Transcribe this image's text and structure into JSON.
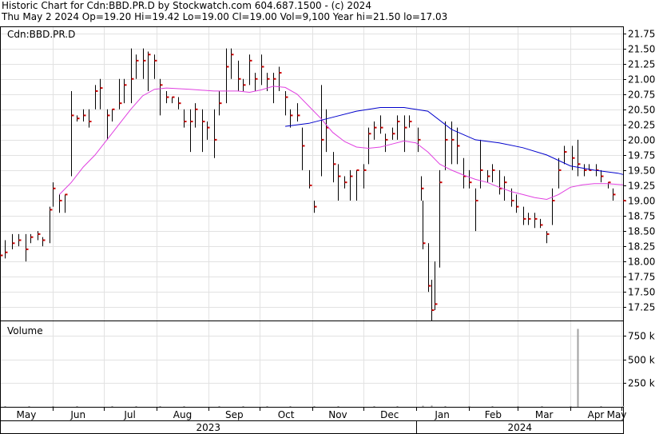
{
  "header": {
    "line1": "Historic Chart for Cdn:BBD.PR.D by Stockwatch.com 604.687.1500 - (c) 2024",
    "line2": "Thu May  2 2024   Op=19.20  Hi=19.42  Lo=19.00  Cl=19.00  Vol=9,100  Year hi=21.50  lo=17.03"
  },
  "price_panel": {
    "symbol": "Cdn:BBD.PR.D",
    "y_ticks": [
      "21.75",
      "21.50",
      "21.25",
      "21.00",
      "20.75",
      "20.50",
      "20.25",
      "20.00",
      "19.75",
      "19.50",
      "19.25",
      "19.00",
      "18.75",
      "18.50",
      "18.25",
      "18.00",
      "17.75",
      "17.50",
      "17.25"
    ]
  },
  "volume_panel": {
    "label": "Volume",
    "y_ticks": [
      "750 k",
      "500 k",
      "250 k"
    ]
  },
  "x_axis": {
    "months": [
      "May",
      "Jun",
      "Jul",
      "Aug",
      "Sep",
      "Oct",
      "Nov",
      "Dec",
      "Jan",
      "Feb",
      "Mar",
      "Apr",
      "May"
    ],
    "years": [
      "2023",
      "2024"
    ]
  },
  "colors": {
    "bars": "#000000",
    "close_tick": "#cc0000",
    "ma_short": "#e040e0",
    "ma_long": "#0000cc",
    "volume": "#a0a0a0"
  },
  "chart_data": {
    "type": "ohlc",
    "title": "Historic Chart for Cdn:BBD.PR.D",
    "ylim": [
      17.03,
      21.85
    ],
    "volume_ylim": [
      0,
      900000
    ],
    "x_start": "2023-05-01",
    "x_end": "2024-05-02",
    "ohlc": [
      [
        "2023-05-01",
        18.45,
        18.1,
        18.1
      ],
      [
        "2023-05-04",
        18.35,
        18.05,
        18.15
      ],
      [
        "2023-05-08",
        18.45,
        18.2,
        18.3
      ],
      [
        "2023-05-12",
        18.45,
        18.25,
        18.35
      ],
      [
        "2023-05-16",
        18.45,
        18.0,
        18.2
      ],
      [
        "2023-05-19",
        18.45,
        18.3,
        18.4
      ],
      [
        "2023-05-23",
        18.5,
        18.35,
        18.45
      ],
      [
        "2023-05-26",
        18.4,
        18.25,
        18.35
      ],
      [
        "2023-05-30",
        18.9,
        18.3,
        18.85
      ],
      [
        "2023-06-01",
        19.3,
        18.9,
        19.2
      ],
      [
        "2023-06-05",
        19.1,
        18.8,
        19.0
      ],
      [
        "2023-06-08",
        19.1,
        18.8,
        19.1
      ],
      [
        "2023-06-12",
        20.8,
        19.4,
        20.4
      ],
      [
        "2023-06-15",
        20.4,
        20.3,
        20.35
      ],
      [
        "2023-06-19",
        20.5,
        20.3,
        20.4
      ],
      [
        "2023-06-22",
        20.5,
        20.2,
        20.3
      ],
      [
        "2023-06-26",
        20.9,
        20.5,
        20.8
      ],
      [
        "2023-06-29",
        21.0,
        20.5,
        20.85
      ],
      [
        "2023-07-03",
        20.5,
        20.0,
        20.4
      ],
      [
        "2023-07-06",
        20.5,
        20.3,
        20.5
      ],
      [
        "2023-07-10",
        21.0,
        20.5,
        20.6
      ],
      [
        "2023-07-13",
        21.0,
        20.6,
        20.9
      ],
      [
        "2023-07-17",
        21.5,
        20.6,
        21.0
      ],
      [
        "2023-07-20",
        21.4,
        21.0,
        21.3
      ],
      [
        "2023-07-24",
        21.5,
        21.0,
        21.3
      ],
      [
        "2023-07-27",
        21.45,
        20.8,
        21.4
      ],
      [
        "2023-07-31",
        21.4,
        21.0,
        21.3
      ],
      [
        "2023-08-03",
        21.0,
        20.4,
        20.9
      ],
      [
        "2023-08-07",
        20.8,
        20.6,
        20.7
      ],
      [
        "2023-08-10",
        20.7,
        20.6,
        20.7
      ],
      [
        "2023-08-14",
        20.7,
        20.5,
        20.6
      ],
      [
        "2023-08-17",
        20.5,
        20.2,
        20.3
      ],
      [
        "2023-08-21",
        20.5,
        19.8,
        20.3
      ],
      [
        "2023-08-24",
        20.6,
        20.2,
        20.5
      ],
      [
        "2023-08-28",
        20.5,
        19.8,
        20.3
      ],
      [
        "2023-08-31",
        20.3,
        20.0,
        20.2
      ],
      [
        "2023-09-04",
        20.5,
        19.7,
        20.0
      ],
      [
        "2023-09-07",
        20.8,
        20.4,
        20.6
      ],
      [
        "2023-09-11",
        21.5,
        20.6,
        21.2
      ],
      [
        "2023-09-14",
        21.5,
        21.0,
        21.4
      ],
      [
        "2023-09-18",
        21.3,
        20.8,
        21.0
      ],
      [
        "2023-09-21",
        21.0,
        20.8,
        20.9
      ],
      [
        "2023-09-25",
        21.4,
        20.9,
        21.3
      ],
      [
        "2023-09-28",
        21.1,
        20.8,
        21.0
      ],
      [
        "2023-10-02",
        21.4,
        20.9,
        21.2
      ],
      [
        "2023-10-05",
        21.1,
        20.8,
        21.0
      ],
      [
        "2023-10-09",
        21.1,
        20.6,
        21.0
      ],
      [
        "2023-10-12",
        21.2,
        20.8,
        21.1
      ],
      [
        "2023-10-16",
        20.8,
        20.4,
        20.7
      ],
      [
        "2023-10-19",
        20.5,
        20.2,
        20.4
      ],
      [
        "2023-10-23",
        20.6,
        20.3,
        20.4
      ],
      [
        "2023-10-26",
        20.2,
        19.5,
        19.9
      ],
      [
        "2023-10-30",
        19.5,
        19.2,
        19.25
      ],
      [
        "2023-11-02",
        19.0,
        18.8,
        18.9
      ],
      [
        "2023-11-06",
        20.9,
        19.4,
        20.0
      ],
      [
        "2023-11-09",
        20.5,
        19.8,
        20.2
      ],
      [
        "2023-11-13",
        19.8,
        19.3,
        19.6
      ],
      [
        "2023-11-16",
        19.6,
        19.0,
        19.4
      ],
      [
        "2023-11-20",
        19.4,
        19.2,
        19.3
      ],
      [
        "2023-11-23",
        19.5,
        19.0,
        19.4
      ],
      [
        "2023-11-27",
        19.5,
        19.0,
        19.5
      ],
      [
        "2023-12-01",
        19.6,
        19.2,
        19.5
      ],
      [
        "2023-12-04",
        20.2,
        19.6,
        20.1
      ],
      [
        "2023-12-07",
        20.3,
        20.0,
        20.2
      ],
      [
        "2023-12-11",
        20.4,
        20.1,
        20.2
      ],
      [
        "2023-12-14",
        20.1,
        19.8,
        20.0
      ],
      [
        "2023-12-18",
        20.2,
        20.0,
        20.1
      ],
      [
        "2023-12-21",
        20.4,
        20.0,
        20.3
      ],
      [
        "2023-12-25",
        20.4,
        19.8,
        20.2
      ],
      [
        "2023-12-28",
        20.4,
        20.2,
        20.3
      ],
      [
        "2024-01-02",
        20.2,
        19.8,
        20.0
      ],
      [
        "2024-01-04",
        19.4,
        19.0,
        19.2
      ],
      [
        "2024-01-05",
        19.0,
        18.2,
        18.3
      ],
      [
        "2024-01-08",
        18.3,
        17.5,
        17.6
      ],
      [
        "2024-01-10",
        17.7,
        17.03,
        17.2
      ],
      [
        "2024-01-12",
        18.0,
        17.2,
        17.3
      ],
      [
        "2024-01-15",
        19.5,
        17.9,
        19.3
      ],
      [
        "2024-01-18",
        20.3,
        19.5,
        20.0
      ],
      [
        "2024-01-22",
        20.3,
        19.6,
        20.0
      ],
      [
        "2024-01-25",
        20.2,
        19.6,
        19.9
      ],
      [
        "2024-01-29",
        19.7,
        19.2,
        19.4
      ],
      [
        "2024-02-01",
        19.5,
        19.2,
        19.3
      ],
      [
        "2024-02-05",
        19.2,
        18.5,
        19.0
      ],
      [
        "2024-02-08",
        20.0,
        19.2,
        19.5
      ],
      [
        "2024-02-12",
        19.5,
        19.3,
        19.4
      ],
      [
        "2024-02-15",
        19.6,
        19.3,
        19.5
      ],
      [
        "2024-02-19",
        19.5,
        19.1,
        19.2
      ],
      [
        "2024-02-22",
        19.4,
        19.0,
        19.3
      ],
      [
        "2024-02-26",
        19.2,
        18.9,
        19.0
      ],
      [
        "2024-02-29",
        19.1,
        18.8,
        18.9
      ],
      [
        "2024-03-04",
        18.9,
        18.6,
        18.7
      ],
      [
        "2024-03-07",
        18.8,
        18.6,
        18.7
      ],
      [
        "2024-03-11",
        18.8,
        18.55,
        18.7
      ],
      [
        "2024-03-14",
        18.7,
        18.55,
        18.6
      ],
      [
        "2024-03-18",
        18.5,
        18.3,
        18.45
      ],
      [
        "2024-03-21",
        19.2,
        18.6,
        19.0
      ],
      [
        "2024-03-25",
        19.7,
        19.2,
        19.5
      ],
      [
        "2024-03-28",
        19.9,
        19.6,
        19.8
      ],
      [
        "2024-04-02",
        19.9,
        19.5,
        19.7
      ],
      [
        "2024-04-05",
        20.0,
        19.4,
        19.6
      ],
      [
        "2024-04-09",
        19.6,
        19.4,
        19.5
      ],
      [
        "2024-04-12",
        19.6,
        19.5,
        19.5
      ],
      [
        "2024-04-16",
        19.6,
        19.4,
        19.5
      ],
      [
        "2024-04-19",
        19.5,
        19.3,
        19.4
      ],
      [
        "2024-04-23",
        19.3,
        19.2,
        19.3
      ],
      [
        "2024-04-26",
        19.2,
        19.0,
        19.1
      ],
      [
        "2024-05-02",
        19.42,
        19.0,
        19.0
      ]
    ],
    "ma_short_points": [
      [
        "2023-06-05",
        19.1
      ],
      [
        "2023-06-12",
        19.3
      ],
      [
        "2023-06-19",
        19.55
      ],
      [
        "2023-06-26",
        19.75
      ],
      [
        "2023-07-03",
        20.0
      ],
      [
        "2023-07-10",
        20.25
      ],
      [
        "2023-07-17",
        20.5
      ],
      [
        "2023-07-24",
        20.72
      ],
      [
        "2023-07-31",
        20.83
      ],
      [
        "2023-08-07",
        20.85
      ],
      [
        "2023-08-21",
        20.83
      ],
      [
        "2023-09-04",
        20.8
      ],
      [
        "2023-09-18",
        20.8
      ],
      [
        "2023-09-25",
        20.78
      ],
      [
        "2023-10-02",
        20.82
      ],
      [
        "2023-10-09",
        20.88
      ],
      [
        "2023-10-16",
        20.86
      ],
      [
        "2023-10-23",
        20.75
      ],
      [
        "2023-10-30",
        20.55
      ],
      [
        "2023-11-06",
        20.35
      ],
      [
        "2023-11-13",
        20.12
      ],
      [
        "2023-11-20",
        19.97
      ],
      [
        "2023-11-27",
        19.88
      ],
      [
        "2023-12-04",
        19.86
      ],
      [
        "2023-12-11",
        19.88
      ],
      [
        "2023-12-18",
        19.93
      ],
      [
        "2023-12-25",
        19.98
      ],
      [
        "2024-01-01",
        19.95
      ],
      [
        "2024-01-08",
        19.8
      ],
      [
        "2024-01-15",
        19.6
      ],
      [
        "2024-01-22",
        19.5
      ],
      [
        "2024-01-29",
        19.42
      ],
      [
        "2024-02-05",
        19.35
      ],
      [
        "2024-02-12",
        19.3
      ],
      [
        "2024-02-19",
        19.22
      ],
      [
        "2024-02-26",
        19.15
      ],
      [
        "2024-03-04",
        19.1
      ],
      [
        "2024-03-11",
        19.05
      ],
      [
        "2024-03-18",
        19.02
      ],
      [
        "2024-03-25",
        19.1
      ],
      [
        "2024-04-01",
        19.22
      ],
      [
        "2024-04-08",
        19.26
      ],
      [
        "2024-04-15",
        19.28
      ],
      [
        "2024-04-22",
        19.28
      ],
      [
        "2024-05-02",
        19.26
      ]
    ],
    "ma_long_points": [
      [
        "2023-10-16",
        20.22
      ],
      [
        "2023-10-30",
        20.27
      ],
      [
        "2023-11-13",
        20.37
      ],
      [
        "2023-11-27",
        20.47
      ],
      [
        "2023-12-11",
        20.53
      ],
      [
        "2023-12-25",
        20.53
      ],
      [
        "2024-01-08",
        20.47
      ],
      [
        "2024-01-22",
        20.17
      ],
      [
        "2024-02-05",
        20.0
      ],
      [
        "2024-02-19",
        19.95
      ],
      [
        "2024-03-04",
        19.87
      ],
      [
        "2024-03-18",
        19.75
      ],
      [
        "2024-04-01",
        19.57
      ],
      [
        "2024-04-15",
        19.5
      ],
      [
        "2024-04-29",
        19.45
      ],
      [
        "2024-05-02",
        19.43
      ]
    ],
    "volume": [
      [
        "2023-05-04",
        6000
      ],
      [
        "2023-05-18",
        5000
      ],
      [
        "2023-06-01",
        7000
      ],
      [
        "2023-06-15",
        8000
      ],
      [
        "2023-07-06",
        9000
      ],
      [
        "2023-07-20",
        7000
      ],
      [
        "2023-08-03",
        6000
      ],
      [
        "2023-08-17",
        8000
      ],
      [
        "2023-09-07",
        9000
      ],
      [
        "2023-09-21",
        6000
      ],
      [
        "2023-10-05",
        7000
      ],
      [
        "2023-10-19",
        5000
      ],
      [
        "2023-11-02",
        9000
      ],
      [
        "2023-11-16",
        6000
      ],
      [
        "2023-12-07",
        7000
      ],
      [
        "2023-12-21",
        8000
      ],
      [
        "2024-01-05",
        12000
      ],
      [
        "2024-01-10",
        14000
      ],
      [
        "2024-01-18",
        9000
      ],
      [
        "2024-02-01",
        6000
      ],
      [
        "2024-02-15",
        7000
      ],
      [
        "2024-03-01",
        6000
      ],
      [
        "2024-03-15",
        8000
      ],
      [
        "2024-04-01",
        7000
      ],
      [
        "2024-04-05",
        820000
      ],
      [
        "2024-04-19",
        6000
      ],
      [
        "2024-05-02",
        9100
      ]
    ]
  }
}
